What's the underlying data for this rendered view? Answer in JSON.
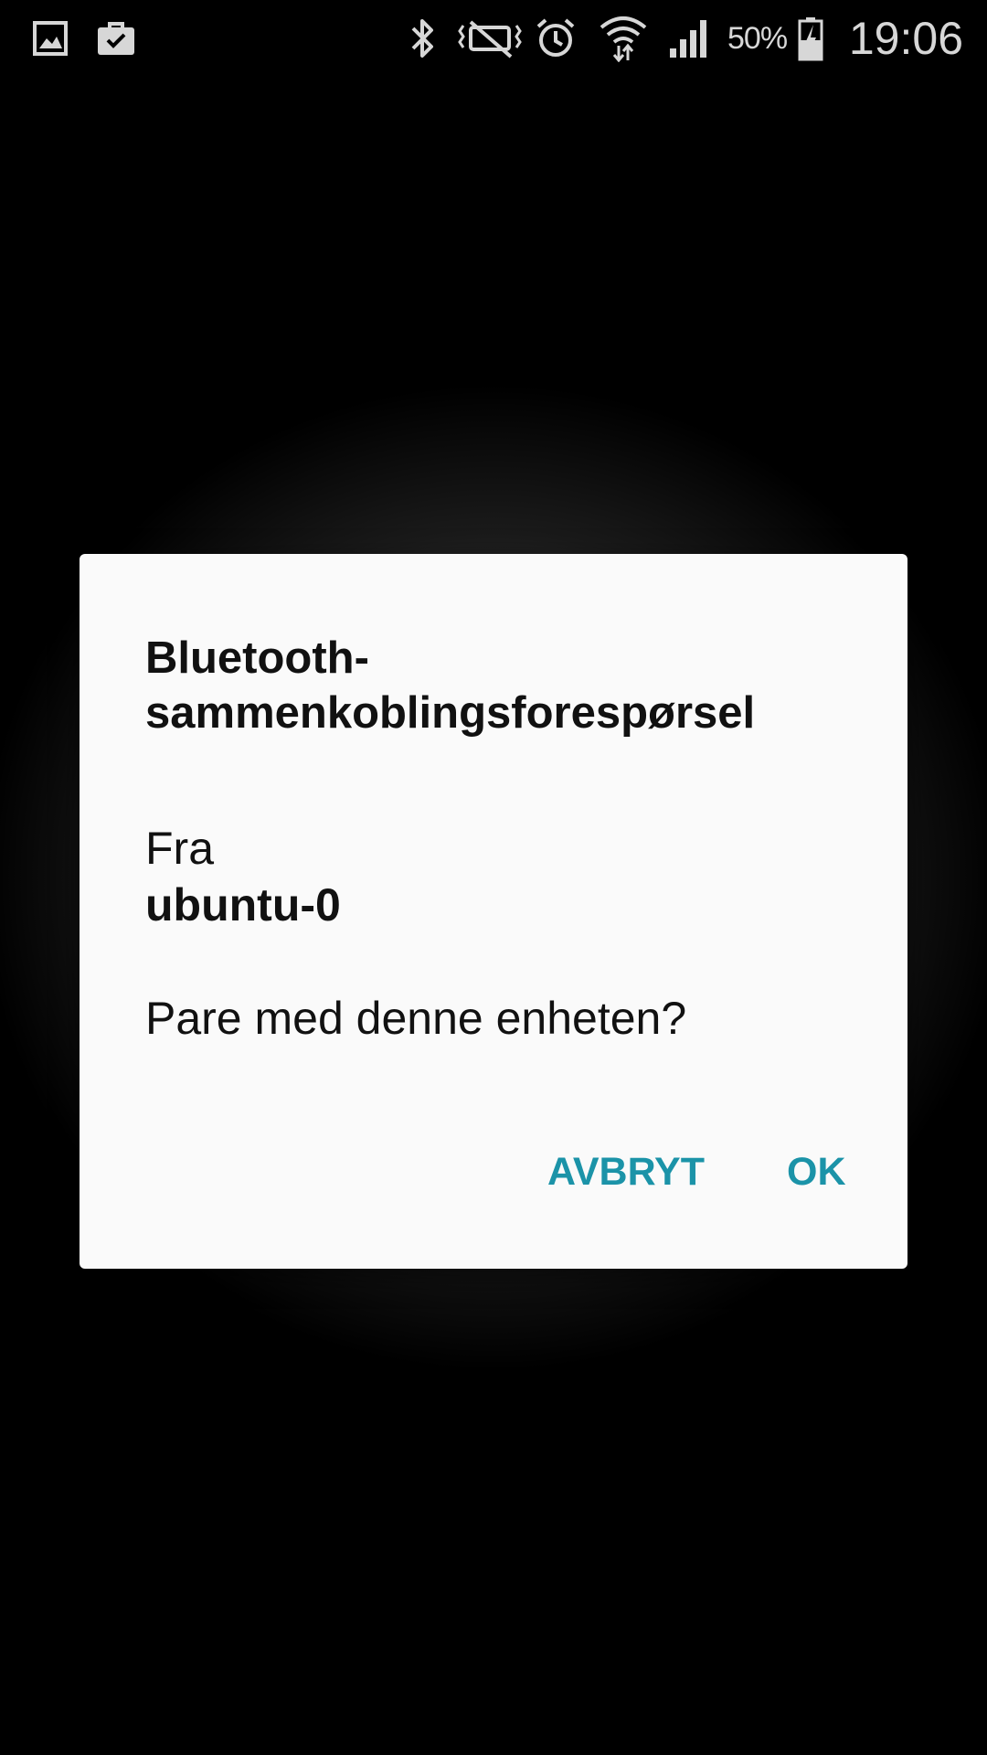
{
  "status_bar": {
    "battery_percent": "50%",
    "time": "19:06",
    "icons": [
      "gallery-icon",
      "briefcase-check-icon",
      "bluetooth-icon",
      "vibrate-mute-icon",
      "alarm-icon",
      "wifi-icon",
      "signal-icon",
      "battery-charging-icon"
    ],
    "color": "#d7d7d7"
  },
  "dialog": {
    "title": "Bluetooth-sammenkoblingsforespørsel",
    "from_label": "Fra",
    "device_name": "ubuntu-0",
    "question": "Pare med denne enheten?",
    "cancel_label": "AVBRYT",
    "ok_label": "OK",
    "accent_color": "#1b93a8"
  }
}
